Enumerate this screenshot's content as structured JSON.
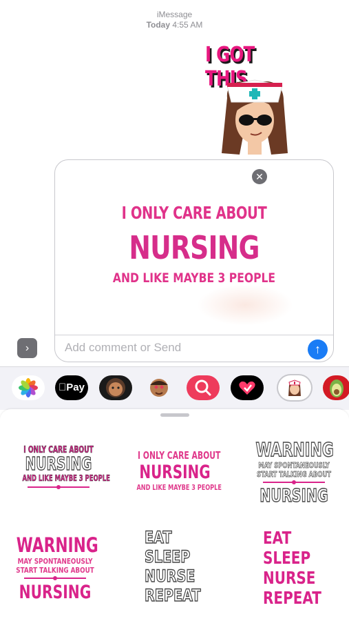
{
  "header": {
    "service": "iMessage",
    "day": "Today",
    "time": "4:55 AM"
  },
  "sent_sticker": {
    "text": "I GOT THIS"
  },
  "preview": {
    "line1": "I ONLY CARE ABOUT",
    "line2": "NURSING",
    "line3": "AND LIKE MAYBE 3 PEOPLE"
  },
  "compose": {
    "placeholder": "Add comment or Send"
  },
  "app_strip": {
    "apps": [
      "photos-icon",
      "apple-pay-icon",
      "memoji-icon",
      "animoji-icon",
      "image-search-icon",
      "digital-touch-icon",
      "nurse-sticker-icon",
      "avocado-sticker-icon"
    ],
    "apple_pay_label": "Pay"
  },
  "stickers": [
    {
      "lines": [
        "I ONLY CARE ABOUT",
        "NURSING",
        "AND LIKE MAYBE 3 PEOPLE"
      ]
    },
    {
      "lines": [
        "I ONLY CARE ABOUT",
        "NURSING",
        "AND LIKE MAYBE 3 PEOPLE"
      ]
    },
    {
      "lines": [
        "WARNING",
        "MAY SPONTANEOUSLY",
        "START TALKING ABOUT",
        "NURSING"
      ]
    },
    {
      "lines": [
        "WARNING",
        "MAY SPONTANEOUSLY",
        "START TALKING ABOUT",
        "NURSING"
      ]
    },
    {
      "lines": [
        "EAT",
        "SLEEP",
        "NURSE",
        "REPEAT"
      ]
    },
    {
      "lines": [
        "EAT",
        "SLEEP",
        "NURSE",
        "REPEAT"
      ]
    }
  ],
  "colors": {
    "accent_pink": "#d9238a",
    "send_blue": "#1a7cf5"
  }
}
